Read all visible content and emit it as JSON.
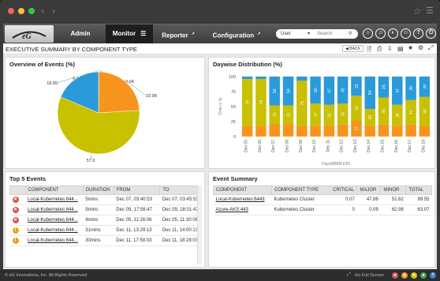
{
  "nav": {
    "tabs": [
      "Admin",
      "Monitor",
      "Reporter",
      "Configuration"
    ],
    "user_select": "User",
    "search_placeholder": "Search"
  },
  "page": {
    "title": "EXECUTIVE SUMMARY BY COMPONENT TYPE",
    "back_label": "BACK"
  },
  "overview": {
    "title": "Overview of Events (%)",
    "chart_data": {
      "type": "pie",
      "values": [
        0.04,
        0.04,
        23.98,
        57.3,
        18.65
      ],
      "labels": [
        "0.04",
        "0.04",
        "23.98",
        "57.3",
        "18.65"
      ],
      "colors": [
        "#2b6fd6",
        "#9a9a9a",
        "#f7941d",
        "#c8c000",
        "#2a9ad8"
      ]
    }
  },
  "daywise": {
    "title": "Daywise Distribution (%)",
    "chart_data": {
      "type": "bar",
      "stacked": true,
      "categories": [
        "Dec 05",
        "Dec 06",
        "Dec 07",
        "Dec 08",
        "Dec 09",
        "Dec 10",
        "Dec 11",
        "Dec 12",
        "Dec 13",
        "Dec 14",
        "Dec 15",
        "Dec 16",
        "Dec 17",
        "Dec 18"
      ],
      "series": [
        {
          "color": "#f7941d",
          "values": [
            18,
            18,
            21,
            21,
            18,
            18,
            18,
            20,
            27,
            18,
            20,
            18,
            20,
            18
          ]
        },
        {
          "color": "#c8c000",
          "values": [
            78,
            78,
            31,
            31,
            75,
            37,
            35,
            35,
            41,
            28,
            45,
            35,
            41,
            48
          ]
        },
        {
          "color": "#2a9ad8",
          "values": [
            4,
            4,
            48,
            48,
            7,
            45,
            47,
            45,
            32,
            54,
            35,
            47,
            39,
            34
          ]
        }
      ],
      "segment_labels": [
        [
          "",
          "78",
          ""
        ],
        [
          "",
          "78",
          ""
        ],
        [
          "",
          "31",
          "50"
        ],
        [
          "",
          "31",
          "50"
        ],
        [
          "",
          "75",
          ""
        ],
        [
          "",
          "37",
          "50"
        ],
        [
          "",
          "35",
          "47"
        ],
        [
          "",
          "35",
          "45"
        ],
        [
          "27",
          "41",
          "32"
        ],
        [
          "",
          "28",
          "54"
        ],
        [
          "",
          "45",
          "35"
        ],
        [
          "",
          "35",
          "47"
        ],
        [
          "",
          "41",
          "39"
        ],
        [
          "",
          "48",
          "34"
        ]
      ],
      "ylabel": "Time in %",
      "xlabel": "Days(MMM DD)",
      "yticks": [
        "0",
        "25",
        "50",
        "75",
        "100"
      ],
      "ylim": [
        0,
        100
      ]
    }
  },
  "top_events": {
    "title": "Top 5 Events",
    "columns": [
      "COMPONENT",
      "DURATION",
      "FROM",
      "TO"
    ],
    "rows": [
      {
        "sev": "critical",
        "component": "Local-Kubernetes:644...",
        "duration": "5mins",
        "from": "Dec 07, 03:40:53",
        "to": "Dec 07, 03:45:53"
      },
      {
        "sev": "critical",
        "component": "Local-Kubernetes:644...",
        "duration": "5mins",
        "from": "Dec 09, 17:56:47",
        "to": "Dec 09, 18:01:47"
      },
      {
        "sev": "critical",
        "component": "Local-Kubernetes:644...",
        "duration": "4mins",
        "from": "Dec 05, 11:26:06",
        "to": "Dec 05, 11:30:06"
      },
      {
        "sev": "major",
        "component": "Local-Kubernetes:644...",
        "duration": "31mins",
        "from": "Dec 11, 13:29:13",
        "to": "Dec 11, 14:00:13"
      },
      {
        "sev": "major",
        "component": "Local-Kubernetes:644...",
        "duration": "30mins",
        "from": "Dec 11, 17:58:03",
        "to": "Dec 11, 18:28:03"
      }
    ]
  },
  "event_summary": {
    "title": "Event Summary",
    "columns": [
      "COMPONENT",
      "COMPONENT TYPE",
      "CRITICAL",
      "MAJOR",
      "MINOR",
      "TOTAL"
    ],
    "rows": [
      {
        "component": "Local-Kubernetes:6443",
        "type": "Kubernetes Cluster",
        "critical": "0.07",
        "major": "47.86",
        "minor": "51.62",
        "total": "99.55"
      },
      {
        "component": "Azure-AKS:443",
        "type": "Kubernetes Cluster",
        "critical": "0",
        "major": "0.09",
        "minor": "62.98",
        "total": "63.07"
      }
    ]
  },
  "footer": {
    "copyright": "© eG Innovations, Inc. All Rights Reserved",
    "fullscreen": "Go Full Screen"
  }
}
